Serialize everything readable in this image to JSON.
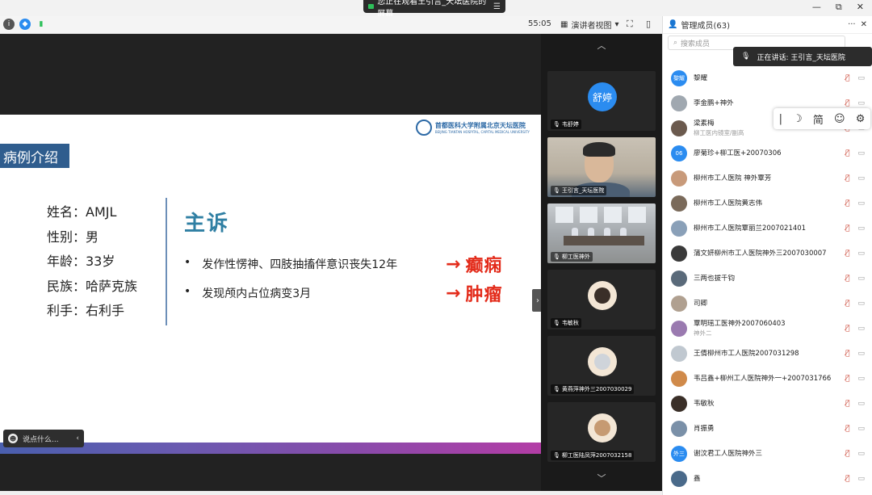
{
  "sharing_bar": {
    "text": "您正在观看王引言_天坛医院的屏幕",
    "menu_icon": "hamburger-icon"
  },
  "window_controls": {
    "minimize": "—",
    "restore": "⧉",
    "close": "✕"
  },
  "toolbar": {
    "timer": "55:05",
    "view_mode": "演讲者视图",
    "view_dropdown": "▾"
  },
  "slide": {
    "hospital_cn": "首都医科大学附属北京天坛医院",
    "hospital_en": "BEIJING TIANTAN HOSPITAL, CAPITAL MEDICAL UNIVERSITY",
    "section_title": "病例介绍",
    "info": [
      "姓名：AMJL",
      "性别：男",
      "年龄：33岁",
      "民族：哈萨克族",
      "利手：右利手"
    ],
    "complaint_title": "主诉",
    "bullets": [
      {
        "text": "发作性愣神、四肢抽搐伴意识丧失12年",
        "result": "癫痫"
      },
      {
        "text": "发现颅内占位病变3月",
        "result": "肿瘤"
      }
    ]
  },
  "chat": {
    "placeholder": "说点什么..."
  },
  "videos": [
    {
      "name": "韦舒婷",
      "avatar_text": "舒婷"
    },
    {
      "name": "王引言_天坛医院"
    },
    {
      "name": "柳工医神外"
    },
    {
      "name": "韦敏秋"
    },
    {
      "name": "黄燕萍神外三2007030029"
    },
    {
      "name": "柳工医陆凤萍2007032158"
    }
  ],
  "panel": {
    "title": "管理成员(63)",
    "search_placeholder": "搜索成员",
    "members": [
      {
        "name": "黎耀",
        "avatar": "黎耀",
        "color": "#2b8cf0"
      },
      {
        "name": "李金鹏+神外",
        "color": "#a0a8b0"
      },
      {
        "name": "梁素梅",
        "sub": "柳工医内镜室/副高",
        "color": "#6b5a4e"
      },
      {
        "name": "廖菊珍+柳工医+20070306",
        "avatar": "06",
        "color": "#2b8cf0"
      },
      {
        "name": "柳州市工人医院 神外覃芳",
        "color": "#c89a7a"
      },
      {
        "name": "柳州市工人医院黄志伟",
        "color": "#7a6a5a"
      },
      {
        "name": "柳州市工人医院覃丽兰2007021401",
        "color": "#8aa0b8"
      },
      {
        "name": "蒲文妍柳州市工人医院神外三2007030007",
        "color": "#3a3a3a"
      },
      {
        "name": "三两也拔千钧",
        "color": "#5a6a7a"
      },
      {
        "name": "司卿",
        "color": "#b0a090"
      },
      {
        "name": "覃明瑶工医神外2007060403",
        "sub": "神外二",
        "color": "#9a7ab0"
      },
      {
        "name": "王倩柳州市工人医院2007031298",
        "color": "#c0c8d0"
      },
      {
        "name": "韦吕鑫+柳州工人医院神外一+2007031766",
        "color": "#d08a4a"
      },
      {
        "name": "韦敏秋",
        "color": "#3a2f28"
      },
      {
        "name": "肖振勇",
        "color": "#7a90a8"
      },
      {
        "name": "谢汶君工人医院神外三",
        "avatar": "外三",
        "color": "#2b8cf0"
      },
      {
        "name": "鑫",
        "color": "#4a6a8a"
      }
    ]
  },
  "speaking_tip": {
    "text": "正在讲话: 王引言_天坛医院"
  },
  "float_tools": [
    "|",
    "☽",
    "简",
    "☺",
    "⚙"
  ],
  "colors": {
    "accent": "#2b8cf0",
    "slide_title_bg": "#2f5d8e",
    "highlight_red": "#e32b1a"
  }
}
